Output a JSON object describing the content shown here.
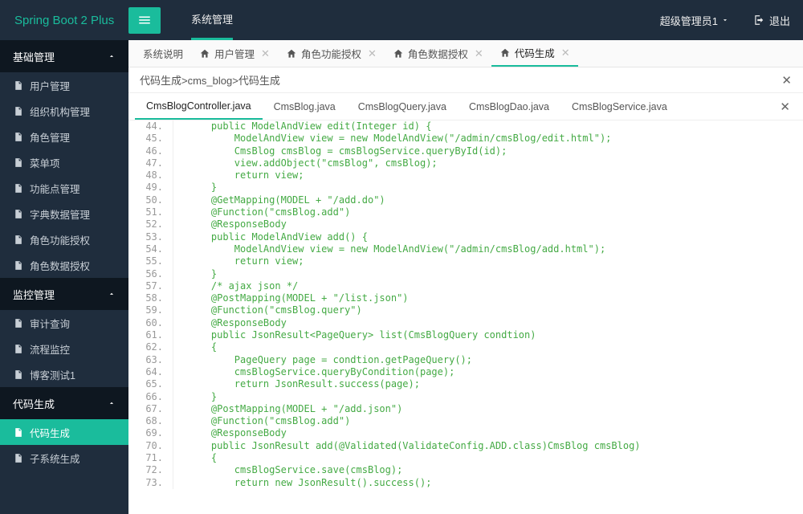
{
  "logo": "Spring Boot 2 Plus",
  "top_nav": "系统管理",
  "user": "超级管理员1",
  "logout": "退出",
  "sidebar": [
    {
      "type": "group",
      "label": "基础管理",
      "open": true
    },
    {
      "type": "item",
      "label": "用户管理"
    },
    {
      "type": "item",
      "label": "组织机构管理"
    },
    {
      "type": "item",
      "label": "角色管理"
    },
    {
      "type": "item",
      "label": "菜单项"
    },
    {
      "type": "item",
      "label": "功能点管理"
    },
    {
      "type": "item",
      "label": "字典数据管理"
    },
    {
      "type": "item",
      "label": "角色功能授权"
    },
    {
      "type": "item",
      "label": "角色数据授权"
    },
    {
      "type": "group",
      "label": "监控管理",
      "open": true
    },
    {
      "type": "item",
      "label": "审计查询"
    },
    {
      "type": "item",
      "label": "流程监控"
    },
    {
      "type": "item",
      "label": "博客测试1"
    },
    {
      "type": "group",
      "label": "代码生成",
      "open": true
    },
    {
      "type": "item",
      "label": "代码生成",
      "active": true
    },
    {
      "type": "item",
      "label": "子系统生成"
    }
  ],
  "tabs": [
    {
      "label": "系统说明",
      "home": false,
      "closeable": false
    },
    {
      "label": "用户管理",
      "home": true,
      "closeable": true
    },
    {
      "label": "角色功能授权",
      "home": true,
      "closeable": true
    },
    {
      "label": "角色数据授权",
      "home": true,
      "closeable": true
    },
    {
      "label": "代码生成",
      "home": true,
      "closeable": true,
      "active": true
    }
  ],
  "breadcrumb": "代码生成>cms_blog>代码生成",
  "file_tabs": [
    {
      "label": "CmsBlogController.java",
      "active": true
    },
    {
      "label": "CmsBlog.java"
    },
    {
      "label": "CmsBlogQuery.java"
    },
    {
      "label": "CmsBlogDao.java"
    },
    {
      "label": "CmsBlogService.java"
    }
  ],
  "code": {
    "start": 44,
    "lines": [
      "    public ModelAndView edit(Integer id) {",
      "        ModelAndView view = new ModelAndView(\"/admin/cmsBlog/edit.html\");",
      "        CmsBlog cmsBlog = cmsBlogService.queryById(id);",
      "        view.addObject(\"cmsBlog\", cmsBlog);",
      "        return view;",
      "    }",
      "    @GetMapping(MODEL + \"/add.do\")",
      "    @Function(\"cmsBlog.add\")",
      "    @ResponseBody",
      "    public ModelAndView add() {",
      "        ModelAndView view = new ModelAndView(\"/admin/cmsBlog/add.html\");",
      "        return view;",
      "    }",
      "    /* ajax json */",
      "    @PostMapping(MODEL + \"/list.json\")",
      "    @Function(\"cmsBlog.query\")",
      "    @ResponseBody",
      "    public JsonResult<PageQuery> list(CmsBlogQuery condtion)",
      "    {",
      "        PageQuery page = condtion.getPageQuery();",
      "        cmsBlogService.queryByCondition(page);",
      "        return JsonResult.success(page);",
      "    }",
      "    @PostMapping(MODEL + \"/add.json\")",
      "    @Function(\"cmsBlog.add\")",
      "    @ResponseBody",
      "    public JsonResult add(@Validated(ValidateConfig.ADD.class)CmsBlog cmsBlog)",
      "    {",
      "        cmsBlogService.save(cmsBlog);",
      "        return new JsonResult().success();"
    ]
  }
}
